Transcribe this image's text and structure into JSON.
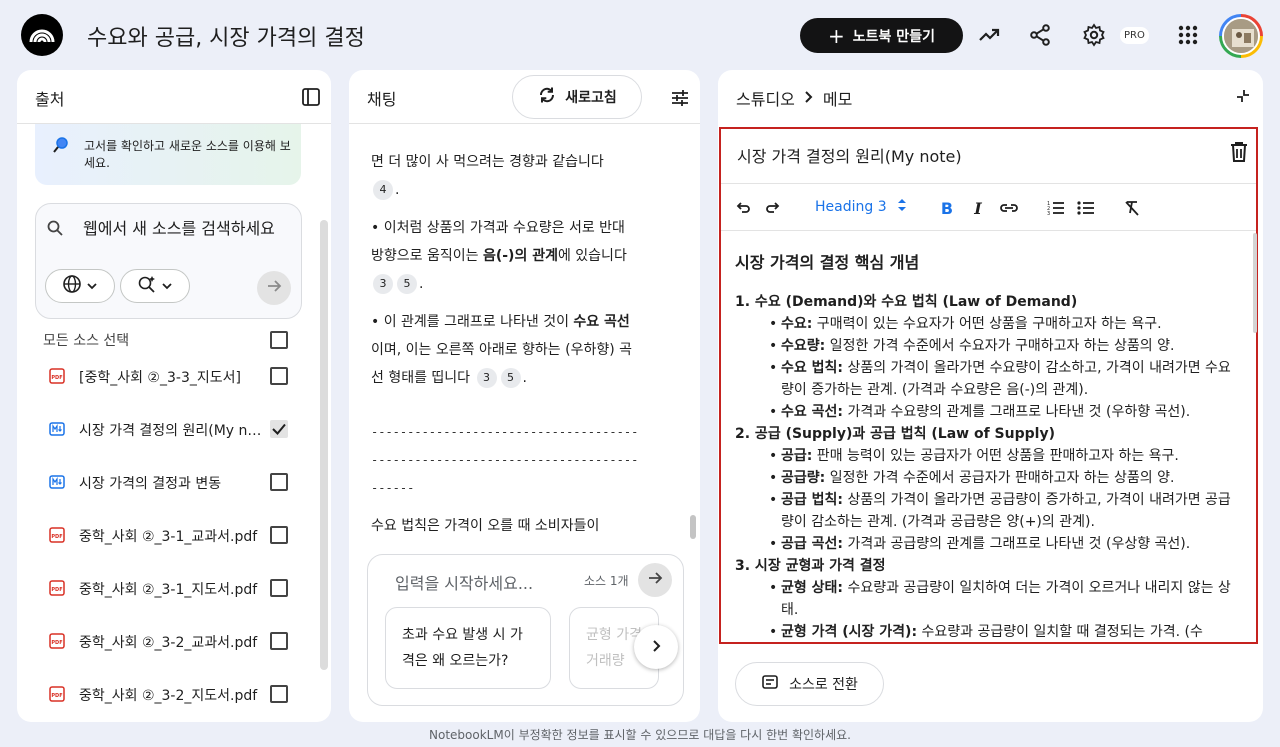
{
  "header": {
    "title": "수요와 공급, 시장 가격의 결정",
    "create_button": "노트북 만들기",
    "pro_badge": "PRO"
  },
  "sources": {
    "title": "출처",
    "tip": "고서를 확인하고 새로운 소스를 이용해 보세요.",
    "search_placeholder": "웹에서 새 소스를 검색하세요",
    "select_all": "모든 소스 선택",
    "items": [
      {
        "label": "[중학_사회 ②_3-3_지도서]",
        "type": "pdf",
        "checked": false
      },
      {
        "label": "시장 가격 결정의 원리(My note)",
        "type": "note",
        "checked": true
      },
      {
        "label": "시장 가격의 결정과 변동",
        "type": "note",
        "checked": false
      },
      {
        "label": "중학_사회 ②_3-1_교과서.pdf",
        "type": "pdf",
        "checked": false
      },
      {
        "label": "중학_사회 ②_3-1_지도서.pdf",
        "type": "pdf",
        "checked": false
      },
      {
        "label": "중학_사회 ②_3-2_교과서.pdf",
        "type": "pdf",
        "checked": false
      },
      {
        "label": "중학_사회 ②_3-2_지도서.pdf",
        "type": "pdf",
        "checked": false
      }
    ]
  },
  "chat": {
    "title": "채팅",
    "refresh": "새로고침",
    "messages": {
      "p1": "면 더 많이 사 먹으려는 경향과 같습니다",
      "p2a": "• 이처럼 상품의 가격과 수요량은 서로 반대 방향으로 움직이는 ",
      "p2b": "음(-)의 관계",
      "p2c": "에 있습니다",
      "p3a": "• 이 관계를 그래프로 나타낸 것이 ",
      "p3b": "수요 곡선",
      "p3c": "이며, 이는 오른쪽 아래로 향하는 (우하향) 곡선 형태를 띱니다",
      "divider": "--------------------------------------------------------------------------------",
      "p4": "수요 법칙은 가격이 오를 때 소비자들이"
    },
    "cites": {
      "c1": "4",
      "c2": "3",
      "c3": "5",
      "c4": "3",
      "c5": "5"
    },
    "input_placeholder": "입력을 시작하세요...",
    "source_count": "소스 1개",
    "suggestions": [
      "초과 수요 발생 시 가격은 왜 오르는가?",
      "균형 가격 거래량"
    ]
  },
  "studio": {
    "crumb_root": "스튜디오",
    "crumb_leaf": "메모",
    "note_title": "시장 가격 결정의 원리(My note)",
    "heading_select": "Heading 3",
    "content": {
      "h": "시장 가격의 결정 핵심 개념",
      "s1": "1. 수요 (Demand)와 수요 법칙 (Law of Demand)",
      "s1_items": [
        {
          "k": "수요:",
          "v": " 구매력이 있는 수요자가 어떤 상품을 구매하고자 하는 욕구."
        },
        {
          "k": "수요량:",
          "v": " 일정한 가격 수준에서 수요자가 구매하고자 하는 상품의 양."
        },
        {
          "k": "수요 법칙:",
          "v": " 상품의 가격이 올라가면 수요량이 감소하고, 가격이 내려가면 수요량이 증가하는 관계. (가격과 수요량은 음(-)의 관계)."
        },
        {
          "k": "수요 곡선:",
          "v": " 가격과 수요량의 관계를 그래프로 나타낸 것 (우하향 곡선)."
        }
      ],
      "s2": "2. 공급 (Supply)과 공급 법칙 (Law of Supply)",
      "s2_items": [
        {
          "k": "공급:",
          "v": " 판매 능력이 있는 공급자가 어떤 상품을 판매하고자 하는 욕구."
        },
        {
          "k": "공급량:",
          "v": " 일정한 가격 수준에서 공급자가 판매하고자 하는 상품의 양."
        },
        {
          "k": "공급 법칙:",
          "v": " 상품의 가격이 올라가면 공급량이 증가하고, 가격이 내려가면 공급량이 감소하는 관계. (가격과 공급량은 양(+)의 관계)."
        },
        {
          "k": "공급 곡선:",
          "v": " 가격과 공급량의 관계를 그래프로 나타낸 것 (우상향 곡선)."
        }
      ],
      "s3": "3. 시장 균형과 가격 결정",
      "s3_items": [
        {
          "k": "균형 상태:",
          "v": " 수요량과 공급량이 일치하여 더는 가격이 오르거나 내리지 않는 상태."
        },
        {
          "k": "균형 가격 (시장 가격):",
          "v": " 수요량과 공급량이 일치할 때 결정되는 가격. (수"
        }
      ]
    },
    "convert_button": "소스로 전환"
  },
  "footer": "NotebookLM이 부정확한 정보를 표시할 수 있으므로 대답을 다시 한번 확인하세요."
}
